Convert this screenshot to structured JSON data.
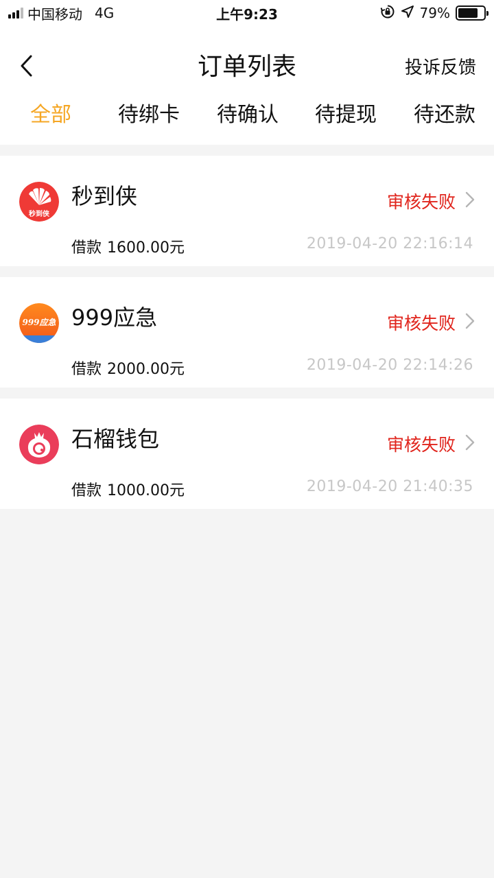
{
  "status_bar": {
    "carrier": "中国移动",
    "network": "4G",
    "time": "上午9:23",
    "battery_percent": "79%",
    "battery_level": 0.79
  },
  "header": {
    "title": "订单列表",
    "feedback_label": "投诉反馈"
  },
  "tabs": [
    {
      "label": "全部",
      "active": true
    },
    {
      "label": "待绑卡",
      "active": false
    },
    {
      "label": "待确认",
      "active": false
    },
    {
      "label": "待提现",
      "active": false
    },
    {
      "label": "待还款",
      "active": false
    }
  ],
  "orders": [
    {
      "app_name": "秒到侠",
      "logo_text": "秒到侠",
      "status": "审核失败",
      "amount_label": "借款",
      "amount": "1600.00元",
      "timestamp": "2019-04-20 22:16:14"
    },
    {
      "app_name": "999应急",
      "logo_text": "999应急",
      "status": "审核失败",
      "amount_label": "借款",
      "amount": "2000.00元",
      "timestamp": "2019-04-20 22:14:26"
    },
    {
      "app_name": "石榴钱包",
      "status": "审核失败",
      "amount_label": "借款",
      "amount": "1000.00元",
      "timestamp": "2019-04-20 21:40:35"
    }
  ],
  "colors": {
    "accent": "#f5a623",
    "status_failed": "#e0241c",
    "timestamp": "#c7c7c7",
    "background": "#f4f4f4"
  },
  "icons": {
    "back": "chevron-left-icon",
    "row_arrow": "chevron-right-icon",
    "rotation_lock": "rotation-lock-icon",
    "location": "location-arrow-icon"
  }
}
